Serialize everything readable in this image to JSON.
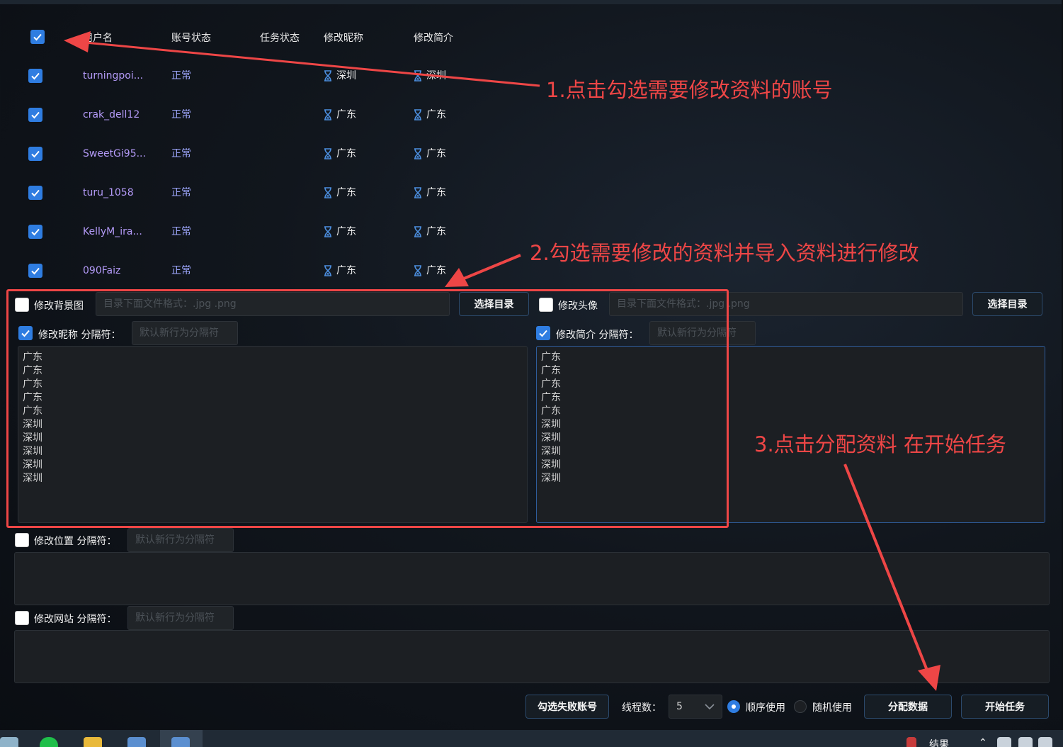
{
  "table": {
    "headers": {
      "username": "用户名",
      "account_status": "账号状态",
      "task_status": "任务状态",
      "modify_nickname": "修改昵称",
      "modify_bio": "修改简介"
    },
    "rows": [
      {
        "checked": true,
        "username": "turningpoi...",
        "account_status": "正常",
        "task_status": "",
        "nickname": "深圳",
        "bio": "深圳"
      },
      {
        "checked": true,
        "username": "crak_dell12",
        "account_status": "正常",
        "task_status": "",
        "nickname": "广东",
        "bio": "广东"
      },
      {
        "checked": true,
        "username": "SweetGi95...",
        "account_status": "正常",
        "task_status": "",
        "nickname": "广东",
        "bio": "广东"
      },
      {
        "checked": true,
        "username": "turu_1058",
        "account_status": "正常",
        "task_status": "",
        "nickname": "广东",
        "bio": "广东"
      },
      {
        "checked": true,
        "username": "KellyM_ira...",
        "account_status": "正常",
        "task_status": "",
        "nickname": "广东",
        "bio": "广东"
      },
      {
        "checked": true,
        "username": "090Faiz",
        "account_status": "正常",
        "task_status": "",
        "nickname": "广东",
        "bio": "广东"
      }
    ]
  },
  "form": {
    "background": {
      "label": "修改背景图",
      "checked": false,
      "placeholder": "目录下面文件格式：.jpg .png",
      "button": "选择目录"
    },
    "avatar": {
      "label": "修改头像",
      "checked": false,
      "placeholder": "目录下面文件格式：.jpg .png",
      "button": "选择目录"
    },
    "nickname": {
      "label": "修改昵称 分隔符：",
      "checked": true,
      "placeholder": "默认新行为分隔符",
      "text": "广东\n广东\n广东\n广东\n广东\n深圳\n深圳\n深圳\n深圳\n深圳"
    },
    "bio": {
      "label": "修改简介 分隔符：",
      "checked": true,
      "placeholder": "默认新行为分隔符",
      "text": "广东\n广东\n广东\n广东\n广东\n深圳\n深圳\n深圳\n深圳\n深圳"
    },
    "location": {
      "label": "修改位置 分隔符：",
      "checked": false,
      "placeholder": "默认新行为分隔符",
      "text": ""
    },
    "website": {
      "label": "修改网站 分隔符：",
      "checked": false,
      "placeholder": "默认新行为分隔符",
      "text": ""
    }
  },
  "bottom": {
    "select_failed": "勾选失败账号",
    "threads_label": "线程数：",
    "threads_value": "5",
    "mode_sequential": "顺序使用",
    "mode_random": "随机使用",
    "mode_selected": "sequential",
    "assign_data": "分配数据",
    "start_task": "开始任务"
  },
  "annotations": {
    "step1": "1.点击勾选需要修改资料的账号",
    "step2": "2.勾选需要修改的资料并导入资料进行修改",
    "step3": "3.点击分配资料 在开始任务"
  },
  "taskbar": {
    "tray_text": "结果"
  },
  "colors": {
    "accent": "#2f7de1",
    "annotation": "#ee4646",
    "username": "#b39af7",
    "status": "#9fa8ff"
  }
}
